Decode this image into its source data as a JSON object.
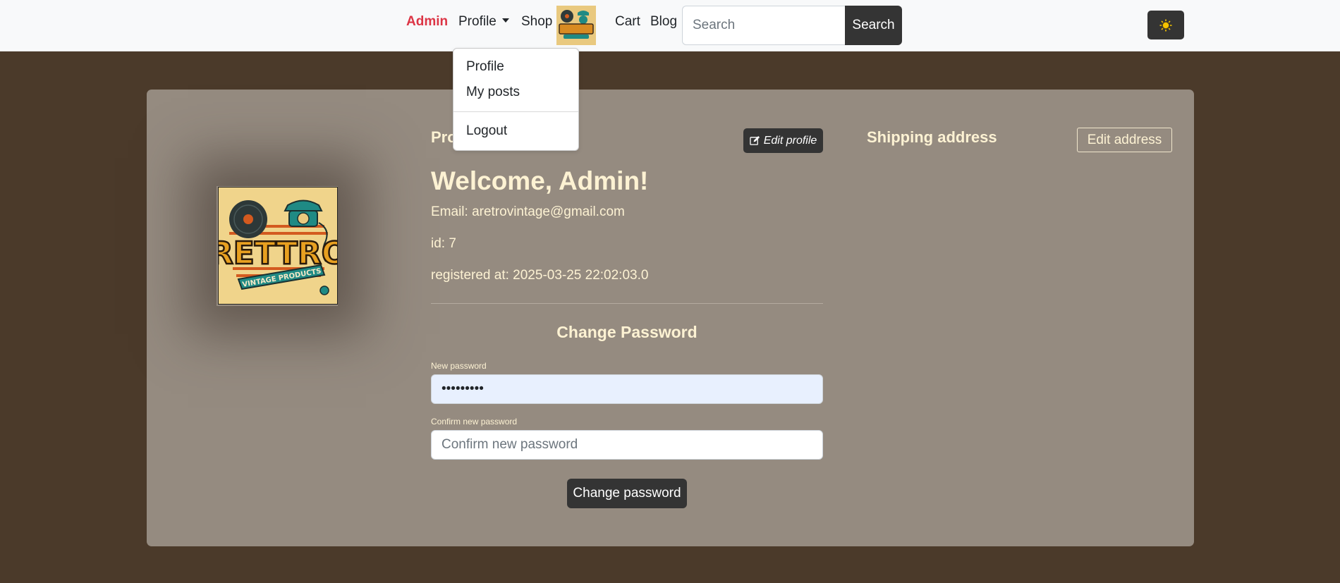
{
  "colors": {
    "page_background": "#4b3a2a",
    "card_background": "#958b80",
    "accent_red": "#dc3545",
    "button_dark": "#343434",
    "cream_text": "#fdf2d3",
    "autofill_blue": "#e8f0fe"
  },
  "navbar": {
    "admin_link": "Admin",
    "profile_link": "Profile",
    "shop_link": "Shop",
    "logo_icon": "rettro-logo-icon",
    "cart_link": "Cart",
    "blog_link": "Blog",
    "search": {
      "placeholder": "Search",
      "value": "",
      "button_label": "Search"
    },
    "theme_toggle_icon": "sun-icon"
  },
  "profile_dropdown": {
    "items": [
      {
        "label": "Profile"
      },
      {
        "label": "My posts"
      },
      {
        "label": "Logout"
      }
    ]
  },
  "profile": {
    "header": "Profile",
    "edit_button": "Edit profile",
    "edit_icon": "edit-icon",
    "avatar_logo": {
      "brand": "RETTRO",
      "tagline": "VINTAGE PRODUCTS"
    },
    "welcome": "Welcome, Admin!",
    "email_line": "Email: aretrovintage@gmail.com",
    "id_line": "id: 7",
    "registered_line": "registered at: 2025-03-25 22:02:03.0"
  },
  "change_password": {
    "title": "Change Password",
    "new_label": "New password",
    "new_value": "•••••••••",
    "confirm_label": "Confirm new password",
    "confirm_placeholder": "Confirm new password",
    "submit_label": "Change password"
  },
  "shipping": {
    "title": "Shipping address",
    "edit_button": "Edit address"
  }
}
